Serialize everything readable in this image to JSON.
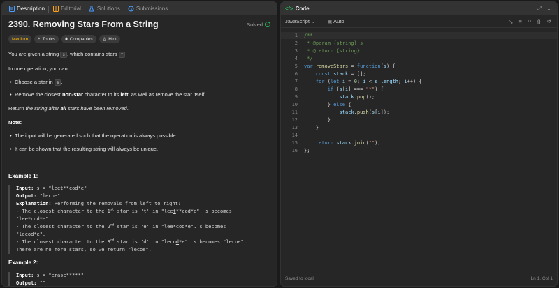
{
  "left_tabs": [
    {
      "label": "Description"
    },
    {
      "label": "Editorial"
    },
    {
      "label": "Solutions"
    },
    {
      "label": "Submissions"
    }
  ],
  "problem": {
    "title": "2390. Removing Stars From a String",
    "status": "Solved",
    "difficulty": "Medium",
    "tags": [
      "Topics",
      "Companies",
      "Hint"
    ]
  },
  "description": {
    "p1_a": "You are given a string ",
    "p1_code": "s",
    "p1_b": ", which contains stars ",
    "p1_code2": "*",
    "p1_c": ".",
    "p2": "In one operation, you can:",
    "b1_a": "Choose a star in ",
    "b1_code": "s",
    "b1_b": ".",
    "b2_a": "Remove the closest ",
    "b2_bold": "non-star",
    "b2_b": " character to its ",
    "b2_bold2": "left",
    "b2_c": ", as well as remove the star itself.",
    "p3_a": "Return ",
    "p3_i": "the string after ",
    "p3_bi": "all",
    "p3_i2": " stars have been removed",
    "p3_b": ".",
    "note": "Note:",
    "n1": "The input will be generated such that the operation is always possible.",
    "n2": "It can be shown that the resulting string will always be unique."
  },
  "example1": {
    "title": "Example 1:",
    "input_lbl": "Input:",
    "input": " s = \"leet**cod*e\"",
    "output_lbl": "Output:",
    "output": " \"lecoe\"",
    "expl_lbl": "Explanation:",
    "expl": " Performing the removals from left to right:",
    "l1_a": "- The closest character to the 1",
    "l1_sup": "st",
    "l1_b": " star is 't' in \"lee",
    "l1_u": "t",
    "l1_c": "**cod*e\". s becomes",
    "l1_d": "\"lee*cod*e\".",
    "l2_a": "- The closest character to the 2",
    "l2_sup": "nd",
    "l2_b": " star is 'e' in \"le",
    "l2_u": "e",
    "l2_c": "*cod*e\". s becomes",
    "l2_d": "\"lecod*e\".",
    "l3_a": "- The closest character to the 3",
    "l3_sup": "rd",
    "l3_b": " star is 'd' in \"leco",
    "l3_u": "d",
    "l3_c": "*e\". s becomes \"lecoe\".",
    "l4": "There are no more stars, so we return \"lecoe\"."
  },
  "example2": {
    "title": "Example 2:",
    "input_lbl": "Input:",
    "input": " s = \"erase*****\"",
    "output_lbl": "Output:",
    "output": " \"\""
  },
  "code_panel": {
    "title": "Code",
    "language": "JavaScript",
    "mode": "Auto",
    "status_left": "Saved to local",
    "status_right": "Ln 1, Col 1"
  },
  "code_lines": [
    "1",
    "2",
    "3",
    "4",
    "5",
    "6",
    "7",
    "8",
    "9",
    "10",
    "11",
    "12",
    "13",
    "14",
    "15",
    "16"
  ],
  "colors": {
    "accent_green": "#2cbb5d",
    "medium": "#ffb800"
  }
}
